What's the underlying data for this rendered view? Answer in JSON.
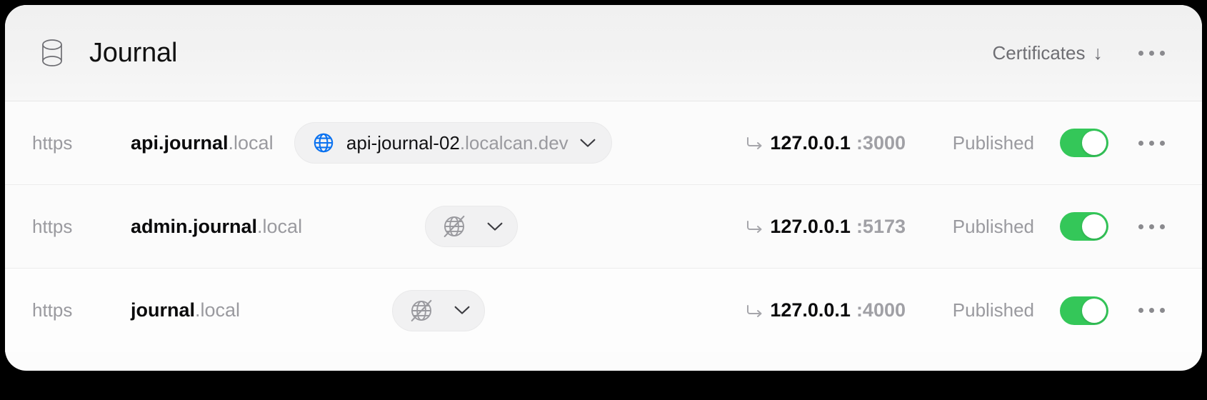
{
  "window": {
    "title": "Journal",
    "db_icon": "database-icon"
  },
  "header": {
    "certificates_label": "Certificates",
    "certificates_arrow": "↓",
    "overflow_icon": "ellipsis-icon"
  },
  "colors": {
    "toggle_on": "#34c759",
    "globe_active": "#0b72f0",
    "globe_disabled": "#9a9a9f",
    "card_bg": "#fcfcfc",
    "page_bg": "#000000",
    "text_primary": "#0b0b0c",
    "text_muted": "#9a9a9f"
  },
  "rows": [
    {
      "scheme": "https",
      "host_main": "api.journal",
      "host_tld": ".local",
      "domain_icon": "globe-icon",
      "domain_enabled": true,
      "domain_main": "api-journal-02",
      "domain_tld": ".localcan.dev",
      "redirect_icon": "redirect-arrow-icon",
      "target_addr": "127.0.0.1",
      "target_port": ":3000",
      "status": "Published",
      "toggle_on": true,
      "overflow_icon": "ellipsis-icon"
    },
    {
      "scheme": "https",
      "host_main": "admin.journal",
      "host_tld": ".local",
      "domain_icon": "globe-off-icon",
      "domain_enabled": false,
      "domain_main": "",
      "domain_tld": "",
      "redirect_icon": "redirect-arrow-icon",
      "target_addr": "127.0.0.1",
      "target_port": ":5173",
      "status": "Published",
      "toggle_on": true,
      "overflow_icon": "ellipsis-icon"
    },
    {
      "scheme": "https",
      "host_main": "journal",
      "host_tld": ".local",
      "domain_icon": "globe-off-icon",
      "domain_enabled": false,
      "domain_main": "",
      "domain_tld": "",
      "redirect_icon": "redirect-arrow-icon",
      "target_addr": "127.0.0.1",
      "target_port": ":4000",
      "status": "Published",
      "toggle_on": true,
      "overflow_icon": "ellipsis-icon"
    }
  ]
}
